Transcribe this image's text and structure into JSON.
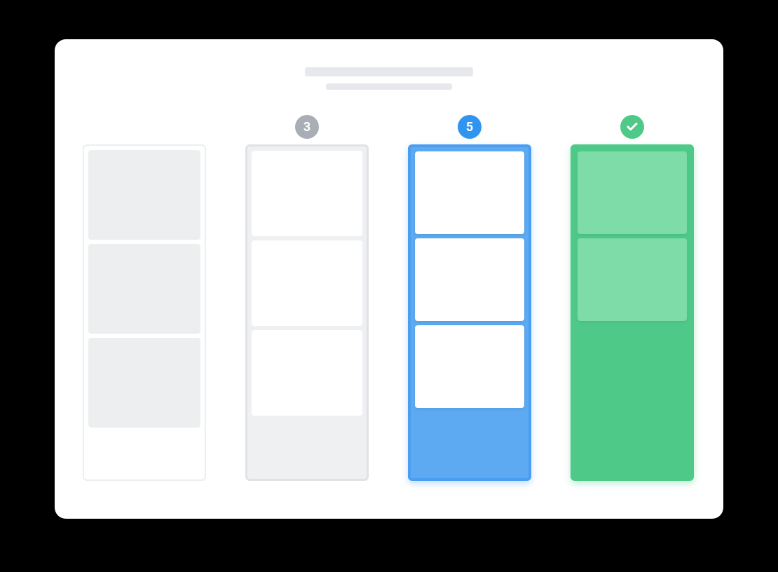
{
  "columns": [
    {
      "badge": null,
      "cards": 3,
      "color": "grey-light"
    },
    {
      "badge": "3",
      "cards": 3,
      "color": "grey",
      "badge_bg": "#a9adb5"
    },
    {
      "badge": "5",
      "cards": 3,
      "color": "blue",
      "badge_bg": "#2f95f0"
    },
    {
      "badge": "check",
      "cards": 2,
      "color": "green",
      "badge_bg": "#4fc988"
    }
  ],
  "colors": {
    "grey_light": "#edeef0",
    "grey_border": "#e0e2e5",
    "grey_badge": "#a9adb5",
    "blue": "#5daaf2",
    "blue_border": "#4a9df1",
    "blue_badge": "#2f95f0",
    "green": "#4fc988",
    "green_card": "#7ddca8"
  }
}
